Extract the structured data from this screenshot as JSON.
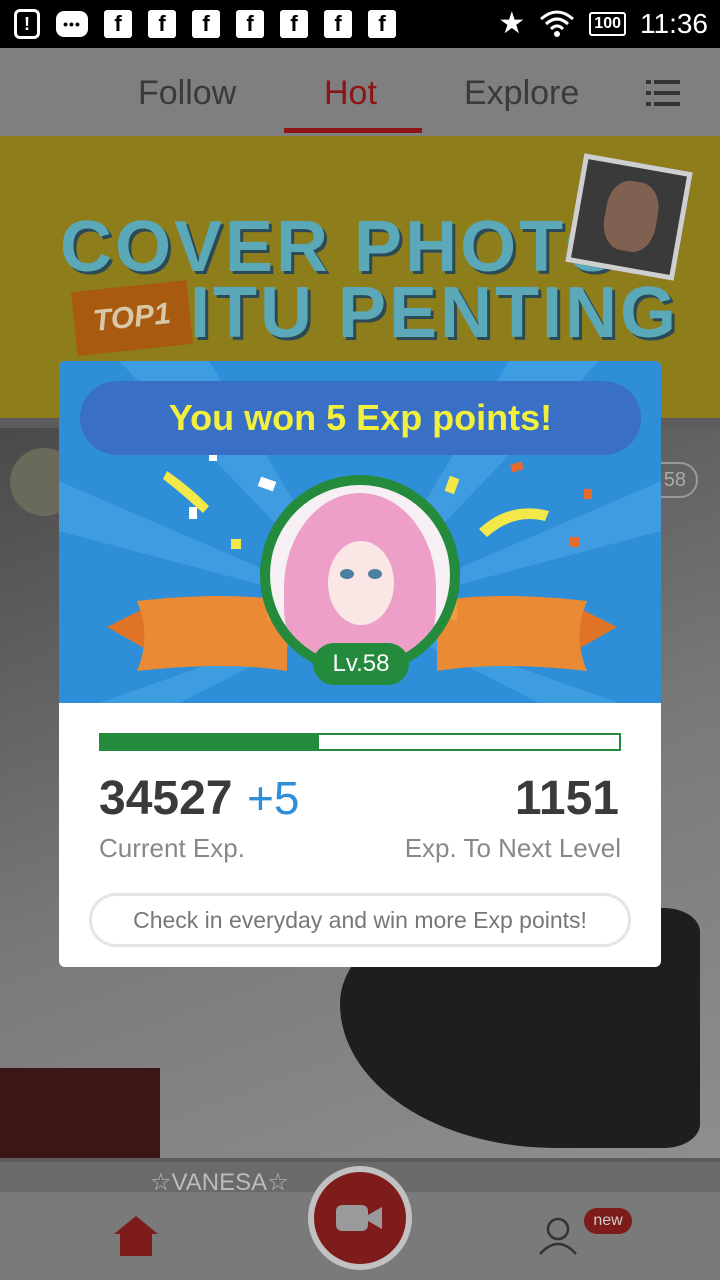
{
  "status_bar": {
    "alert_glyph": "!",
    "chat_glyph": "•••",
    "app_icon_letter": "f",
    "battery": "100",
    "time": "11:36"
  },
  "tabs": [
    {
      "label": "Follow",
      "active": false
    },
    {
      "label": "Hot",
      "active": true
    },
    {
      "label": "Explore",
      "active": false
    }
  ],
  "banner": {
    "line1": "COVER PHOTO",
    "line2": "ITU PENTING",
    "badge": "TOP1"
  },
  "feed": {
    "viewer_count": "58",
    "next_streamer_name": "☆VANESA☆"
  },
  "modal": {
    "headline": "You won 5 Exp points!",
    "level_label": "Lv.58",
    "progress_fraction": 0.42,
    "current_exp": "34527",
    "exp_gained": "+5",
    "exp_to_next": "1151",
    "current_exp_label": "Current Exp.",
    "next_level_label": "Exp. To Next Level",
    "checkin_label": "Check in everyday and win more Exp points!"
  },
  "bottom_nav": {
    "new_badge": "new"
  },
  "colors": {
    "accent_red": "#c62828",
    "modal_blue": "#2f8ed8",
    "level_green": "#248a3c",
    "headline_yellow": "#f2f03e"
  }
}
